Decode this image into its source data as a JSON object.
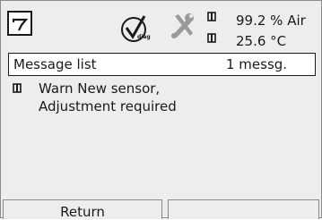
{
  "header": {
    "home_icon": "probe-home-icon",
    "diagnostics_icon": "check-circle-icon",
    "diagnostics_label": "diag",
    "maintenance_icon": "wrench-screwdriver-icon",
    "readings": [
      {
        "icon": "sensor-value-icon",
        "text": "99.2 % Air"
      },
      {
        "icon": "sensor-value-icon",
        "text": "25.6 °C"
      }
    ]
  },
  "message_list": {
    "title": "Message list",
    "count": "1 messg."
  },
  "messages": [
    {
      "icon": "warning-square-icon",
      "lines": [
        "Warn New sensor,",
        "Adjustment required"
      ]
    }
  ],
  "softkeys": {
    "left_label": "Return",
    "right_label": ""
  }
}
